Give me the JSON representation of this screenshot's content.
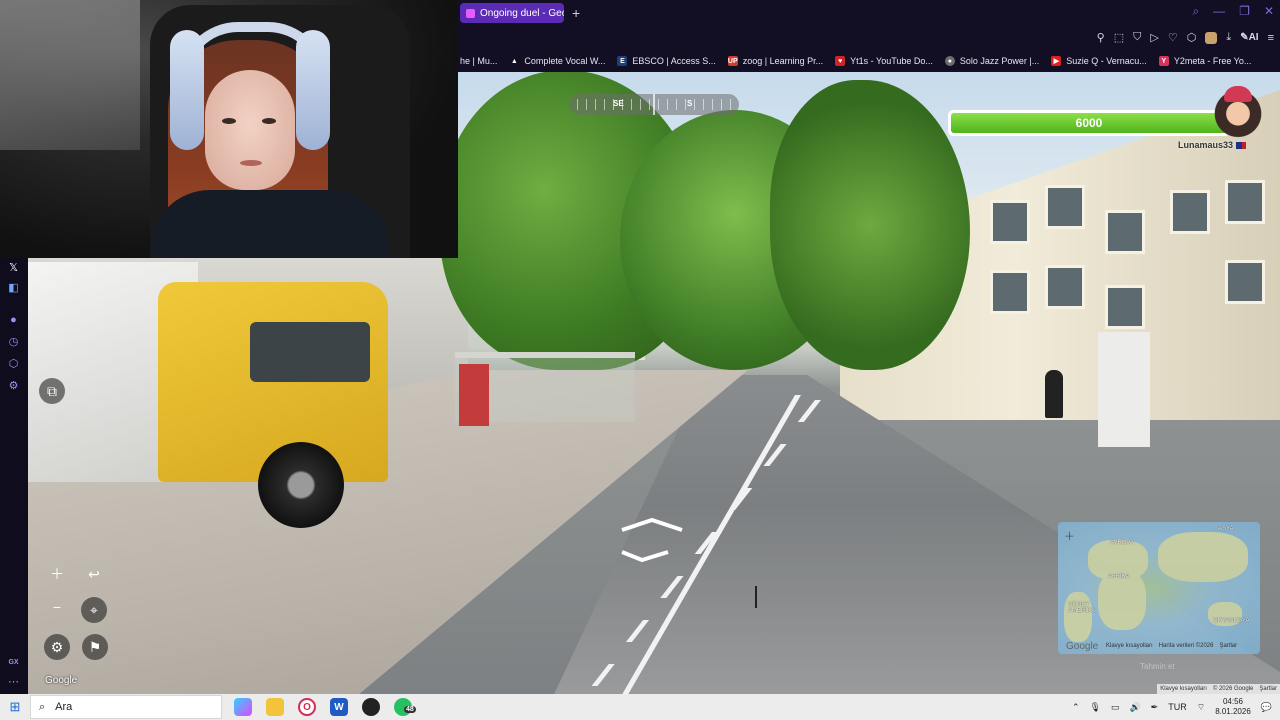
{
  "browser": {
    "tab_title": "Ongoing duel - GeoGu",
    "new_tab": "+",
    "bookmarks": [
      {
        "label": "he | Mu...",
        "color": "#1f1f1f",
        "glyph": ""
      },
      {
        "label": "Complete Vocal W...",
        "color": "#1f1f1f",
        "glyph": "▲"
      },
      {
        "label": "EBSCO | Access S...",
        "color": "#1d3f7a",
        "glyph": "E"
      },
      {
        "label": "zoog | Learning Pr...",
        "color": "#d23a2c",
        "glyph": "UP"
      },
      {
        "label": "Yt1s - YouTube Do...",
        "color": "#d22222",
        "glyph": "♥"
      },
      {
        "label": "Solo Jazz Power |...",
        "color": "#6d6d6d",
        "glyph": "●"
      },
      {
        "label": "Suzie Q - Vernacu...",
        "color": "#e02020",
        "glyph": "▶"
      },
      {
        "label": "Y2meta - Free Yo...",
        "color": "#d9325b",
        "glyph": "Y"
      }
    ],
    "toolbar_ai": "AI"
  },
  "game": {
    "compass": {
      "left": "SE",
      "right": "S"
    },
    "health": 6000,
    "health_label": "6000",
    "player_name": "Lunamaus33",
    "google_watermark": "Google",
    "minimap": {
      "labels": [
        "ASYA",
        "AVRUPA",
        "AFRİKA",
        "GÜNEY AMERİKA",
        "OKYANUSYA"
      ],
      "google_logo": "Google",
      "footer": [
        "Klavye kısayolları",
        "Harita verileri ©2026",
        "Şartlar"
      ],
      "place_button": "Tahmin et"
    },
    "attribution": [
      "Klavye kısayolları",
      "© 2026 Google",
      "Şartlar"
    ]
  },
  "taskbar": {
    "search_placeholder": "Ara",
    "whatsapp_badge": "48",
    "language": "TUR",
    "time": "04:56",
    "date": "8.01.2026"
  }
}
